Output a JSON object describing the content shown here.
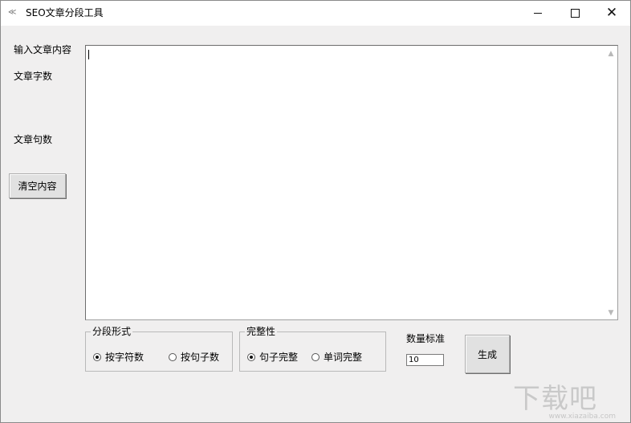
{
  "window": {
    "title": "SEO文章分段工具",
    "controls": [
      "minimize",
      "maximize",
      "close"
    ]
  },
  "labels": {
    "input_content": "输入文章内容",
    "word_count": "文章字数",
    "sentence_count": "文章句数",
    "quantity_standard": "数量标准"
  },
  "buttons": {
    "clear_content": "清空内容",
    "generate": "生成"
  },
  "textarea": {
    "value": ""
  },
  "segment_mode": {
    "title": "分段形式",
    "options": [
      {
        "label": "按字符数",
        "selected": true
      },
      {
        "label": "按句子数",
        "selected": false
      }
    ]
  },
  "integrity": {
    "title": "完整性",
    "options": [
      {
        "label": "句子完整",
        "selected": true
      },
      {
        "label": "单词完整",
        "selected": false
      }
    ]
  },
  "quantity_input": {
    "value": "10"
  },
  "watermark": {
    "brand": "下载吧",
    "site": "www.xiazaiba.com"
  }
}
